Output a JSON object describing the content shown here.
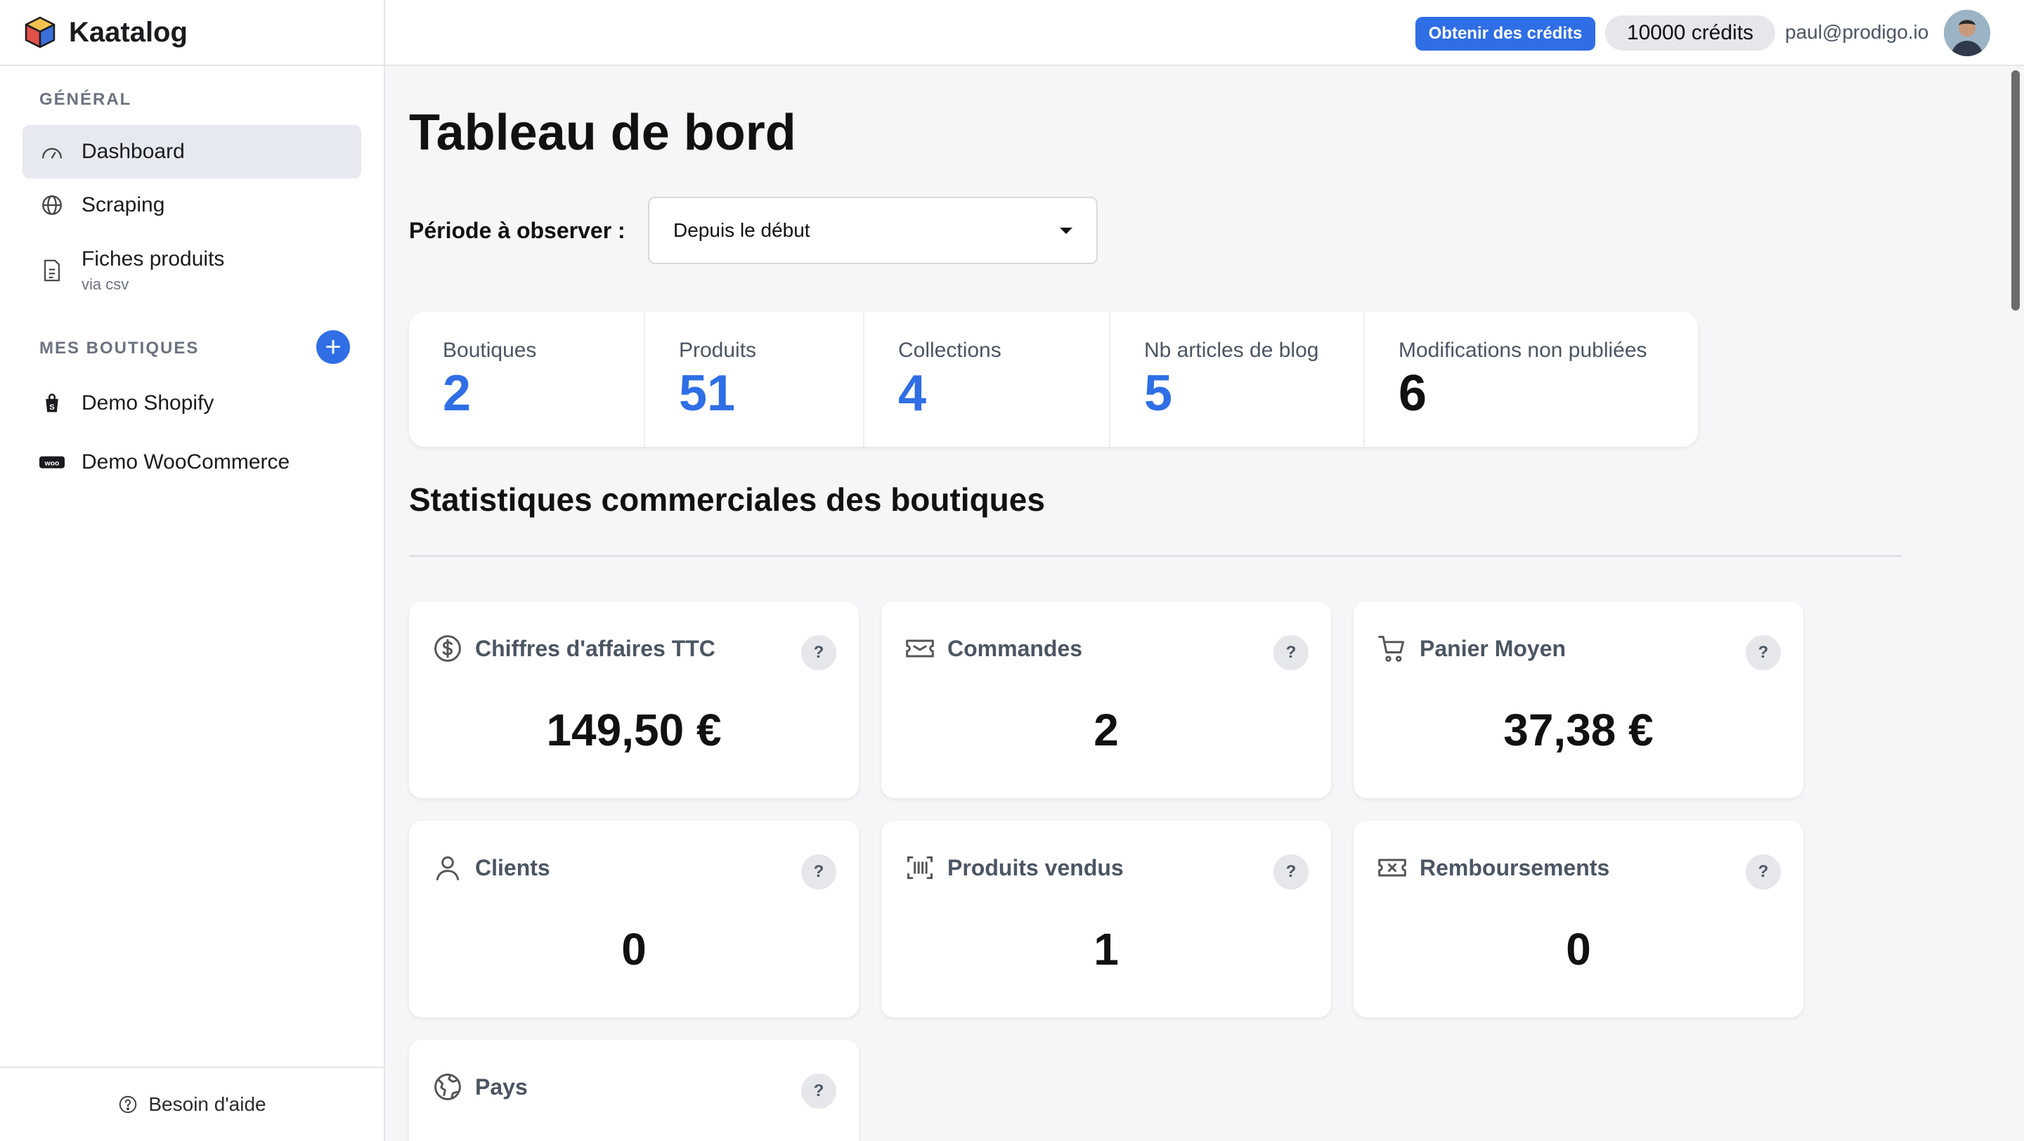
{
  "app": {
    "name": "Kaatalog"
  },
  "sidebar": {
    "general_title": "GÉNÉRAL",
    "nav": [
      {
        "label": "Dashboard",
        "icon": "gauge-icon"
      },
      {
        "label": "Scraping",
        "icon": "globe-icon"
      },
      {
        "label": "Fiches produits",
        "sublabel": "via csv",
        "icon": "file-icon"
      }
    ],
    "shops_title": "MES BOUTIQUES",
    "add_shop": "+",
    "shops": [
      {
        "label": "Demo Shopify",
        "icon": "shopify-icon"
      },
      {
        "label": "Demo WooCommerce",
        "icon": "woocommerce-icon"
      }
    ],
    "help_label": "Besoin d'aide"
  },
  "topbar": {
    "get_credits": "Obtenir des crédits",
    "credits": "10000 crédits",
    "email": "paul@prodigo.io"
  },
  "main": {
    "title": "Tableau de bord",
    "period_label": "Période à observer :",
    "period_value": "Depuis le début",
    "stats": [
      {
        "label": "Boutiques",
        "value": "2"
      },
      {
        "label": "Produits",
        "value": "51"
      },
      {
        "label": "Collections",
        "value": "4"
      },
      {
        "label": "Nb articles de blog",
        "value": "5"
      },
      {
        "label": "Modifications non publiées",
        "value": "6"
      }
    ],
    "section_title": "Statistiques commerciales des boutiques",
    "cards": [
      {
        "label": "Chiffres d'affaires TTC",
        "value": "149,50 €",
        "icon": "dollar-circle-icon",
        "help": "?"
      },
      {
        "label": "Commandes",
        "value": "2",
        "icon": "ticket-icon",
        "help": "?"
      },
      {
        "label": "Panier Moyen",
        "value": "37,38 €",
        "icon": "cart-icon",
        "help": "?"
      },
      {
        "label": "Clients",
        "value": "0",
        "icon": "user-icon",
        "help": "?"
      },
      {
        "label": "Produits vendus",
        "value": "1",
        "icon": "barcode-icon",
        "help": "?"
      },
      {
        "label": "Remboursements",
        "value": "0",
        "icon": "refund-icon",
        "help": "?"
      },
      {
        "label": "Pays",
        "value": "",
        "icon": "world-icon",
        "help": "?"
      }
    ]
  },
  "colors": {
    "accent": "#2f6ee5",
    "sidebar_active": "#e6e9ef",
    "background": "#f5f6f8"
  }
}
